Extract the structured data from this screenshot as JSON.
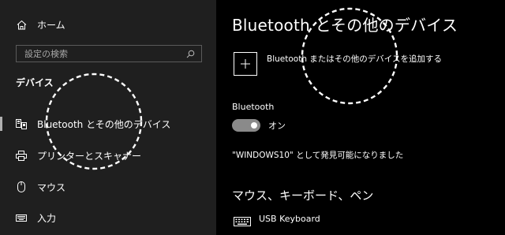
{
  "sidebar": {
    "home_label": "ホーム",
    "search_placeholder": "設定の検索",
    "section_heading": "デバイス",
    "items": [
      {
        "label": "Bluetooth とその他のデバイス",
        "icon": "bluetooth-devices-icon",
        "selected": true
      },
      {
        "label": "プリンターとスキャナー",
        "icon": "printer-icon",
        "selected": false
      },
      {
        "label": "マウス",
        "icon": "mouse-icon",
        "selected": false
      },
      {
        "label": "入力",
        "icon": "keyboard-input-icon",
        "selected": false
      }
    ]
  },
  "main": {
    "title": "Bluetooth とその他のデバイス",
    "add_device_label": "Bluetooth またはその他のデバイスを追加する",
    "bluetooth_label": "Bluetooth",
    "bluetooth_toggle_state": "オン",
    "bluetooth_on": true,
    "discoverable_text": "\"WINDOWS10\" として発見可能になりました",
    "mouse_keyboard_pen_heading": "マウス、キーボード、ペン",
    "devices": [
      {
        "name": "USB Keyboard",
        "icon": "keyboard-icon"
      }
    ]
  },
  "colors": {
    "sidebar_bg": "#1f1f1f",
    "main_bg": "#000000",
    "text": "#ffffff",
    "toggle_on": "#8a8a8a"
  }
}
